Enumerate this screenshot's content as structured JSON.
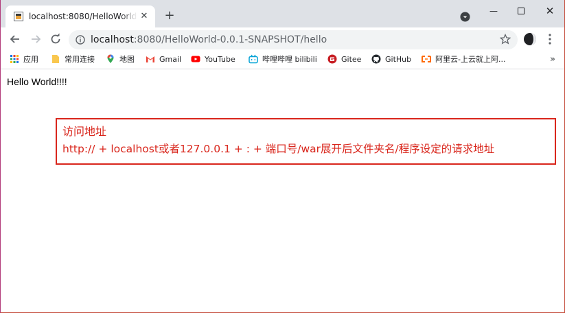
{
  "browser": {
    "tab_title": "localhost:8080/HelloWorld-0.0.1-SNAPSHOT/hello",
    "new_tab_symbol": "+",
    "url_host": "localhost",
    "url_rest": ":8080/HelloWorld-0.0.1-SNAPSHOT/hello"
  },
  "bookmarks": [
    {
      "label": "应用",
      "icon": "apps-grid-icon",
      "color": "#1a73e8"
    },
    {
      "label": "常用连接",
      "icon": "folder-icon",
      "color": "#f9c74f"
    },
    {
      "label": "地图",
      "icon": "maps-pin-icon",
      "color": "#34a853"
    },
    {
      "label": "Gmail",
      "icon": "gmail-icon",
      "color": "#ea4335"
    },
    {
      "label": "YouTube",
      "icon": "youtube-icon",
      "color": "#ff0000"
    },
    {
      "label": "哔哩哔哩 bilibili",
      "icon": "bilibili-icon",
      "color": "#00a1d6"
    },
    {
      "label": "Gitee",
      "icon": "gitee-icon",
      "color": "#c71d23"
    },
    {
      "label": "GitHub",
      "icon": "github-icon",
      "color": "#24292e"
    },
    {
      "label": "阿里云-上云就上阿...",
      "icon": "aliyun-icon",
      "color": "#ff6a00"
    }
  ],
  "page": {
    "body_text": "Hello World!!!!",
    "annotation_title": "访问地址",
    "annotation_text": "http:// + localhost或者127.0.0.1 + : + 端口号/war展开后文件夹名/程序设定的请求地址",
    "annotation_color": "#d9261c"
  }
}
